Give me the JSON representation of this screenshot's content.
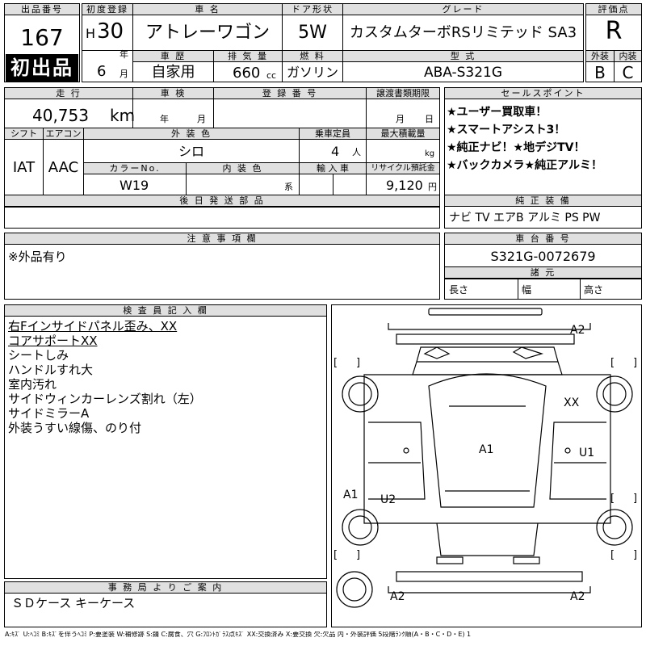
{
  "header": {
    "lot_no_label": "出品番号",
    "lot_no": "167",
    "first_listing": "初出品",
    "first_reg_label": "初度登録",
    "era": "H",
    "year": "30",
    "year_unit": "年",
    "month": "6",
    "month_unit": "月",
    "model_name_label": "車 名",
    "model_name": "アトレーワゴン",
    "door_label": "ドア形状",
    "door": "5W",
    "grade_label": "グレード",
    "grade": "カスタムターボRSリミテッド SA3",
    "score_label": "評価点",
    "score": "R",
    "history_label": "車 歴",
    "history": "自家用",
    "displacement_label": "排 気 量",
    "displacement": "660",
    "displacement_unit": "cc",
    "fuel_label": "燃 料",
    "fuel": "ガソリン",
    "model_code_label": "型 式",
    "model_code": "ABA-S321G",
    "exterior_grade_label": "外装",
    "exterior_grade": "B",
    "interior_grade_label": "内装",
    "interior_grade": "C"
  },
  "row2": {
    "mileage_label": "走 行",
    "mileage": "40,753",
    "mileage_unit": "km",
    "inspection_label": "車 検",
    "insp_year": "年",
    "insp_month": "月",
    "reg_no_label": "登 録 番 号",
    "transfer_label": "譲渡書類期限",
    "transfer_month": "月",
    "transfer_day": "日",
    "shift_label": "シフト",
    "shift": "IAT",
    "ac_label": "エアコン",
    "ac": "AAC",
    "ext_color_label": "外 装 色",
    "ext_color": "シロ",
    "capacity_label": "乗車定員",
    "capacity": "4",
    "capacity_unit": "人",
    "max_load_label": "最大積載量",
    "max_load_unit": "kg",
    "color_no_label": "カラーNo.",
    "color_no": "W19",
    "int_color_label": "内 装 色",
    "int_color_unit": "系",
    "import_label": "輸 入 車",
    "recycle_label": "リサイクル預託金",
    "recycle": "9,120",
    "recycle_unit": "円",
    "later_parts_label": "後 日 発 送 部 品"
  },
  "sales_points": {
    "label": "セールスポイント",
    "items": [
      "★ユーザー買取車！",
      "★スマートアシスト3！",
      "★純正ナビ！★地デジTV！",
      "★バックカメラ★純正アルミ！"
    ]
  },
  "equipment": {
    "label": "純 正 装 備",
    "value": "ナビ TV エアB アルミ PS PW"
  },
  "notes": {
    "label": "注 意 事 項 欄",
    "value": "※外品有り"
  },
  "chassis": {
    "label": "車 台 番 号",
    "value": "S321G-0072679",
    "dims_label": "諸 元",
    "length_label": "長さ",
    "width_label": "幅",
    "height_label": "高さ"
  },
  "inspector": {
    "label": "検 査 員 記 入 欄",
    "lines": [
      "右Fインサイドパネル歪み、XX",
      "コアサポートXX",
      "シートしみ",
      "ハンドルすれ大",
      "室内汚れ",
      "サイドウィンカーレンズ割れ（左）",
      "サイドミラーA",
      "外装うすい線傷、のり付"
    ]
  },
  "diagram_marks": {
    "front_right": "A2",
    "right_front_panel": "XX",
    "roof": "A1",
    "right_side": "U1",
    "left_side": "A1",
    "left_rear": "U2",
    "rear_left": "A2",
    "rear_right": "A2"
  },
  "office": {
    "label": "事 務 局 よ り ご 案 内",
    "value": "ＳＤケース キーケース"
  },
  "legend": "A:ｷｽﾞ U:ﾍｺﾐ B:ｷｽﾞを伴うﾍｺﾐ P:要塗装 W:補修跡 S:錆 C:腐食、穴 G:ﾌﾛﾝﾄｶﾞﾗｽ点ｷｽﾞ XX:交換済み X:要交換 欠:欠品 内・外装評価 5段階ﾗﾝｸ順(A・B・C・D・E) 1"
}
